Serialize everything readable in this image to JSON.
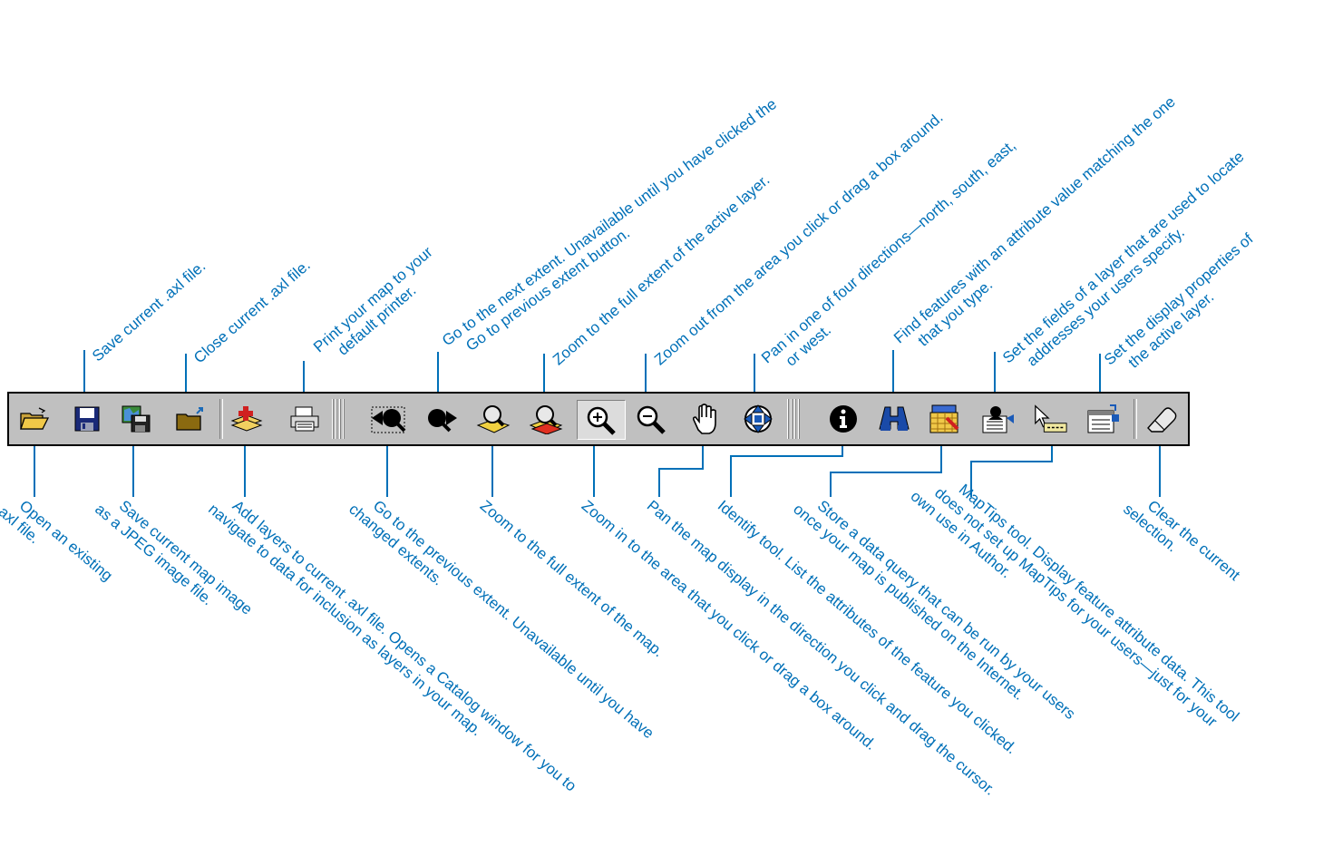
{
  "toolbar": {
    "buttons": [
      {
        "icon": "open-folder-icon",
        "tooltip_callout": "Open an existing .axl file."
      },
      {
        "icon": "save-disk-icon",
        "tooltip_callout": "Save current .axl file."
      },
      {
        "icon": "save-image-icon",
        "tooltip_callout": "Save current map image as a JPEG image file."
      },
      {
        "icon": "close-folder-icon",
        "tooltip_callout": "Close current .axl file."
      },
      {
        "icon": "add-layer-icon",
        "tooltip_callout": "Add layers to current .axl file."
      },
      {
        "icon": "printer-icon",
        "tooltip_callout": "Print your map to your default printer."
      },
      {
        "icon": "previous-extent-icon",
        "tooltip_callout": "Go to the previous extent."
      },
      {
        "icon": "next-extent-icon",
        "tooltip_callout": "Go to the next extent."
      },
      {
        "icon": "full-extent-map-icon",
        "tooltip_callout": "Zoom to the full extent of the map."
      },
      {
        "icon": "full-extent-layer-icon",
        "tooltip_callout": "Zoom to the full extent of the active layer."
      },
      {
        "icon": "zoom-in-icon",
        "tooltip_callout": "Zoom in",
        "pressed": true
      },
      {
        "icon": "zoom-out-icon",
        "tooltip_callout": "Zoom out"
      },
      {
        "icon": "pan-hand-icon",
        "tooltip_callout": "Pan the map display"
      },
      {
        "icon": "pan-directions-icon",
        "tooltip_callout": "Pan in one of four directions"
      },
      {
        "icon": "identify-icon",
        "tooltip_callout": "Identify tool"
      },
      {
        "icon": "find-binoculars-icon",
        "tooltip_callout": "Find features"
      },
      {
        "icon": "query-icon",
        "tooltip_callout": "Store a data query"
      },
      {
        "icon": "geocode-icon",
        "tooltip_callout": "Set the fields of a layer for addresses"
      },
      {
        "icon": "maptips-icon",
        "tooltip_callout": "MapTips tool"
      },
      {
        "icon": "layer-properties-icon",
        "tooltip_callout": "Set the display properties"
      },
      {
        "icon": "eraser-icon",
        "tooltip_callout": "Clear the current selection."
      }
    ],
    "colors": {
      "face": "#c0c0c0",
      "callout": "#0070b8"
    }
  },
  "top_labels": [
    {
      "lines": [
        "Save current .axl file."
      ]
    },
    {
      "lines": [
        "Close current .axl file."
      ]
    },
    {
      "lines": [
        "Print your map to your",
        "default printer."
      ]
    },
    {
      "lines": [
        "Go to the next extent. Unavailable until you have clicked the",
        "Go to previous extent button."
      ]
    },
    {
      "lines": [
        "Zoom to the full extent of the active layer."
      ]
    },
    {
      "lines": [
        "Zoom out from the area you click or drag a box around."
      ]
    },
    {
      "lines": [
        "Pan in one of four directions—north, south, east,",
        "or west."
      ]
    },
    {
      "lines": [
        "Find features with an attribute value matching the one",
        "that you type."
      ]
    },
    {
      "lines": [
        "Set the fields of a layer that are used to locate",
        "addresses your users specify."
      ]
    },
    {
      "lines": [
        "Set the display properties of",
        "the active layer."
      ]
    }
  ],
  "bottom_labels": [
    {
      "lines": [
        "Open an existing",
        ".axl file."
      ]
    },
    {
      "lines": [
        "Save current map image",
        "as a JPEG image file."
      ]
    },
    {
      "lines": [
        "Add layers to current .axl file. Opens a Catalog window for you to",
        "navigate to data for inclusion as layers in your map."
      ]
    },
    {
      "lines": [
        "Go to the previous extent. Unavailable until you have",
        "changed extents."
      ]
    },
    {
      "lines": [
        "Zoom to the full extent of the map."
      ]
    },
    {
      "lines": [
        "Zoom in to the area that you click or drag a box around."
      ]
    },
    {
      "lines": [
        "Pan the map display in the direction you click and drag the cursor."
      ]
    },
    {
      "lines": [
        "Identify tool. List the attributes of the feature you clicked."
      ]
    },
    {
      "lines": [
        "Store a data query that can be run by your users",
        "once your map is published on the Internet."
      ]
    },
    {
      "lines": [
        "MapTips tool. Display feature attribute data. This tool",
        "does not set up MapTips for your users—just for your",
        "own use in Author."
      ]
    },
    {
      "lines": [
        "Clear the current",
        "selection."
      ]
    }
  ]
}
